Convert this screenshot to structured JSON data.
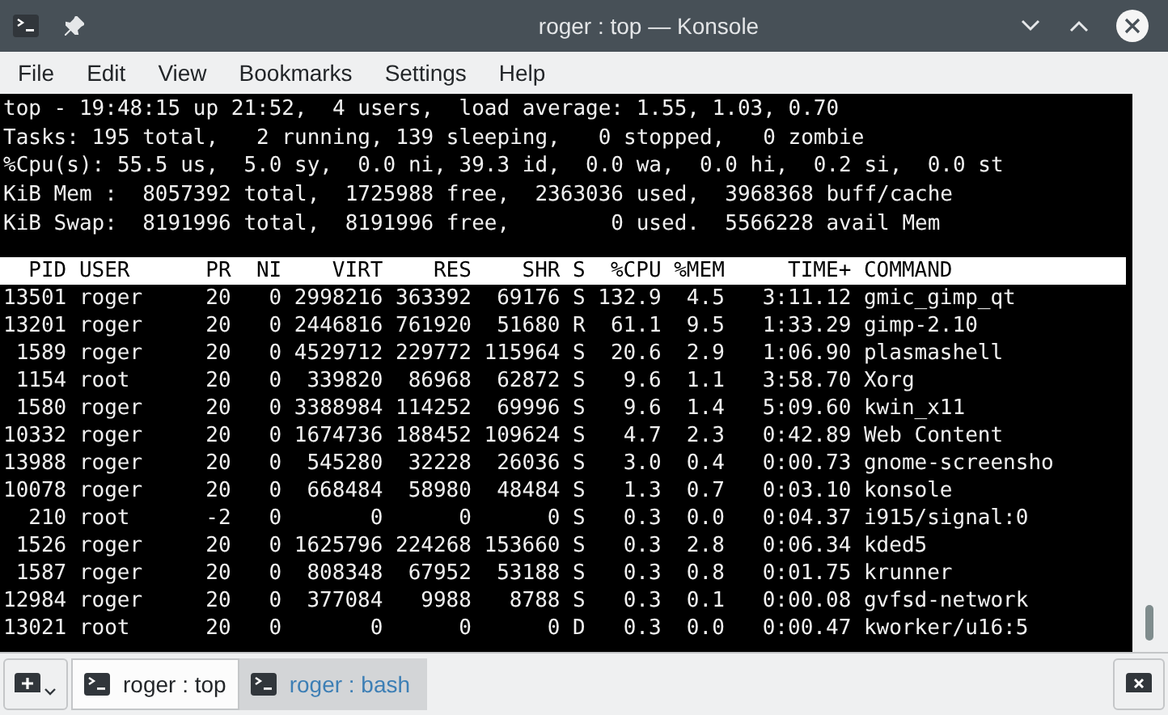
{
  "window": {
    "title": "roger : top — Konsole"
  },
  "menu": [
    "File",
    "Edit",
    "View",
    "Bookmarks",
    "Settings",
    "Help"
  ],
  "terminal": {
    "summary": [
      "top - 19:48:15 up 21:52,  4 users,  load average: 1.55, 1.03, 0.70",
      "Tasks: 195 total,   2 running, 139 sleeping,   0 stopped,   0 zombie",
      "%Cpu(s): 55.5 us,  5.0 sy,  0.0 ni, 39.3 id,  0.0 wa,  0.0 hi,  0.2 si,  0.0 st",
      "KiB Mem :  8057392 total,  1725988 free,  2363036 used,  3968368 buff/cache",
      "KiB Swap:  8191996 total,  8191996 free,        0 used.  5566228 avail Mem"
    ],
    "columns": [
      "PID",
      "USER",
      "PR",
      "NI",
      "VIRT",
      "RES",
      "SHR",
      "S",
      "%CPU",
      "%MEM",
      "TIME+",
      "COMMAND"
    ],
    "rows": [
      [
        "13501",
        "roger",
        "20",
        "0",
        "2998216",
        "363392",
        "69176",
        "S",
        "132.9",
        "4.5",
        "3:11.12",
        "gmic_gimp_qt"
      ],
      [
        "13201",
        "roger",
        "20",
        "0",
        "2446816",
        "761920",
        "51680",
        "R",
        "61.1",
        "9.5",
        "1:33.29",
        "gimp-2.10"
      ],
      [
        "1589",
        "roger",
        "20",
        "0",
        "4529712",
        "229772",
        "115964",
        "S",
        "20.6",
        "2.9",
        "1:06.90",
        "plasmashell"
      ],
      [
        "1154",
        "root",
        "20",
        "0",
        "339820",
        "86968",
        "62872",
        "S",
        "9.6",
        "1.1",
        "3:58.70",
        "Xorg"
      ],
      [
        "1580",
        "roger",
        "20",
        "0",
        "3388984",
        "114252",
        "69996",
        "S",
        "9.6",
        "1.4",
        "5:09.60",
        "kwin_x11"
      ],
      [
        "10332",
        "roger",
        "20",
        "0",
        "1674736",
        "188452",
        "109624",
        "S",
        "4.7",
        "2.3",
        "0:42.89",
        "Web Content"
      ],
      [
        "13988",
        "roger",
        "20",
        "0",
        "545280",
        "32228",
        "26036",
        "S",
        "3.0",
        "0.4",
        "0:00.73",
        "gnome-screensho"
      ],
      [
        "10078",
        "roger",
        "20",
        "0",
        "668484",
        "58980",
        "48484",
        "S",
        "1.3",
        "0.7",
        "0:03.10",
        "konsole"
      ],
      [
        "210",
        "root",
        "-2",
        "0",
        "0",
        "0",
        "0",
        "S",
        "0.3",
        "0.0",
        "0:04.37",
        "i915/signal:0"
      ],
      [
        "1526",
        "roger",
        "20",
        "0",
        "1625796",
        "224268",
        "153660",
        "S",
        "0.3",
        "2.8",
        "0:06.34",
        "kded5"
      ],
      [
        "1587",
        "roger",
        "20",
        "0",
        "808348",
        "67952",
        "53188",
        "S",
        "0.3",
        "0.8",
        "0:01.75",
        "krunner"
      ],
      [
        "12984",
        "roger",
        "20",
        "0",
        "377084",
        "9988",
        "8788",
        "S",
        "0.3",
        "0.1",
        "0:00.08",
        "gvfsd-network"
      ],
      [
        "13021",
        "root",
        "20",
        "0",
        "0",
        "0",
        "0",
        "D",
        "0.3",
        "0.0",
        "0:00.47",
        "kworker/u16:5"
      ]
    ]
  },
  "tabs": [
    {
      "label": "roger : top",
      "selected": true
    },
    {
      "label": "roger : bash",
      "selected": false
    }
  ]
}
